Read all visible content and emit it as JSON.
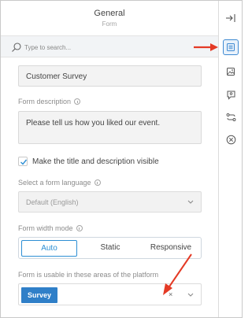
{
  "header": {
    "title": "General",
    "subtitle": "Form"
  },
  "search": {
    "placeholder": "Type to search..."
  },
  "form": {
    "title_value": "Customer Survey",
    "description_label": "Form description",
    "description_value": "Please tell us how you liked our event.",
    "visible_checkbox_label": "Make the title and description visible",
    "visible_checked": true,
    "language_label": "Select a form language",
    "language_value": "Default (English)",
    "width_mode_label": "Form width mode",
    "width_modes": [
      "Auto",
      "Static",
      "Responsive"
    ],
    "width_mode_selected": "Auto",
    "areas_label": "Form is usable in these areas of the platform",
    "areas_selected": [
      "Survey"
    ],
    "clear_symbol": "×"
  },
  "rail": {
    "icons": [
      "collapse-panel-icon",
      "form-settings-icon",
      "image-icon",
      "feedback-icon",
      "workflow-icon",
      "close-circle-icon"
    ],
    "active": "form-settings-icon"
  },
  "colors": {
    "accent": "#2d8fd4",
    "chip": "#2f7fc8",
    "annotation_arrow": "#e43a25"
  }
}
